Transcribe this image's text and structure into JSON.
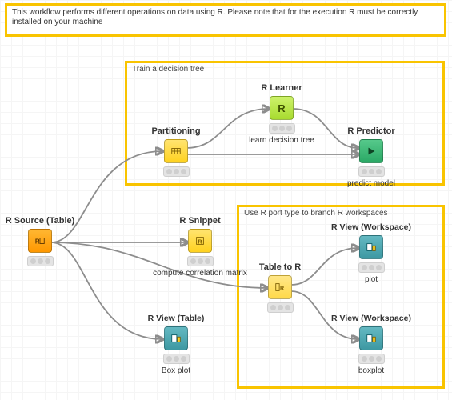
{
  "banner": {
    "text": "This workflow performs different operations on data using R. Please note that for the execution R must be correctly installed on your machine"
  },
  "groups": {
    "train": {
      "title": "Train a decision tree"
    },
    "branch": {
      "title": "Use R port type to branch R workspaces"
    }
  },
  "nodes": {
    "rsource": {
      "title": "R Source (Table)",
      "subtitle": "",
      "glyph": "R▦",
      "status": "idle"
    },
    "partition": {
      "title": "Partitioning",
      "subtitle": "",
      "glyph": "▦▦",
      "status": "idle"
    },
    "rlearner": {
      "title": "R Learner",
      "subtitle": "learn decision tree",
      "glyph": "R",
      "status": "idle"
    },
    "rpredictor": {
      "title": "R Predictor",
      "subtitle": "predict model",
      "glyph": "▶",
      "status": "idle"
    },
    "rsnippet": {
      "title": "R Snippet",
      "subtitle": "compute correlation matrix",
      "glyph": "R",
      "status": "idle"
    },
    "rviewtable": {
      "title": "R View (Table)",
      "subtitle": "Box plot",
      "glyph": "▦◨",
      "status": "idle"
    },
    "tabletor": {
      "title": "Table to R",
      "subtitle": "",
      "glyph": "▦R",
      "status": "idle"
    },
    "rviewws1": {
      "title": "R View (Workspace)",
      "subtitle": "plot",
      "glyph": "▦◨",
      "status": "idle"
    },
    "rviewws2": {
      "title": "R View (Workspace)",
      "subtitle": "boxplot",
      "glyph": "▦◨",
      "status": "idle"
    }
  },
  "edges": [
    {
      "from": "rsource",
      "to": "partition"
    },
    {
      "from": "rsource",
      "to": "rsnippet"
    },
    {
      "from": "rsource",
      "to": "rviewtable"
    },
    {
      "from": "rsource",
      "to": "tabletor"
    },
    {
      "from": "partition",
      "to": "rlearner"
    },
    {
      "from": "partition",
      "to": "rpredictor"
    },
    {
      "from": "rlearner",
      "to": "rpredictor"
    },
    {
      "from": "tabletor",
      "to": "rviewws1"
    },
    {
      "from": "tabletor",
      "to": "rviewws2"
    }
  ],
  "colors": {
    "accent": "#f9c400",
    "wire": "#8d8d8d"
  }
}
